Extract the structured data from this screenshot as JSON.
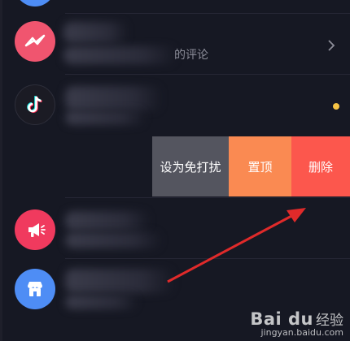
{
  "conversations": [
    {
      "name": "",
      "message_fragment": "的评论",
      "avatar_icon": "messenger-bolt-icon",
      "avatar_color": "#f0556f",
      "trailing": "chevron-right-icon"
    },
    {
      "name": "",
      "message_fragment": "",
      "avatar_icon": "tiktok-note-icon",
      "avatar_color": "#1b1b24",
      "trailing": "unread-dot",
      "dot_color": "#f6c344"
    },
    {
      "name": "",
      "message_fragment": "",
      "swiped": true
    },
    {
      "name": "",
      "message_fragment": "",
      "avatar_icon": "megaphone-icon",
      "avatar_color": "#f03a5e"
    },
    {
      "name": "",
      "message_fragment": "",
      "avatar_icon": "shop-icon",
      "avatar_color": "#4e8df5"
    }
  ],
  "swipe_actions": {
    "mute_label": "设为免打扰",
    "pin_label": "置顶",
    "delete_label": "删除",
    "colors": {
      "mute": "#54555f",
      "pin": "#fa8a52",
      "delete": "#fc574d"
    }
  },
  "annotation": {
    "type": "arrow",
    "color": "#e02a2a",
    "points_to": "delete-button"
  },
  "watermark": {
    "logo": "Bai  du",
    "chinese": "经验",
    "url": "jingyan.baidu.com"
  }
}
